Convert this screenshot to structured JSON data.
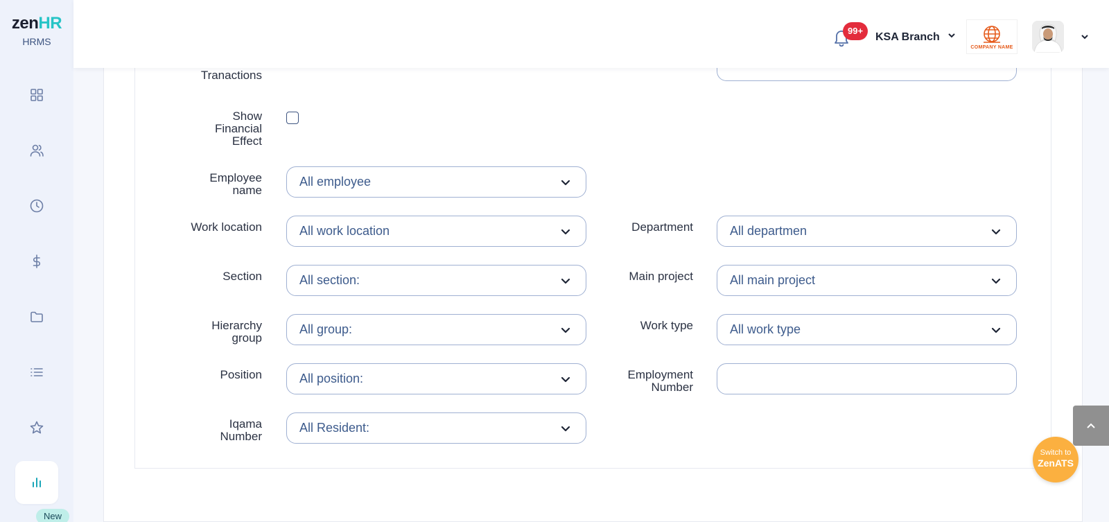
{
  "brand": {
    "logo_part1": "zen",
    "logo_part2": "HR",
    "subtitle": "HRMS",
    "accent": "#26c4c6"
  },
  "sidebar": {
    "items": [
      {
        "icon": "grid-icon"
      },
      {
        "icon": "users-icon"
      },
      {
        "icon": "clock-icon"
      },
      {
        "icon": "dollar-icon"
      },
      {
        "icon": "folder-icon"
      },
      {
        "icon": "list-icon"
      },
      {
        "icon": "star-icon"
      },
      {
        "icon": "bar-chart-icon",
        "active": true
      }
    ],
    "new_badge": "New"
  },
  "header": {
    "notifications": "99+",
    "branch": "KSA Branch",
    "company_name": "COMPANY NAME"
  },
  "form": {
    "partial_top_left_label": "Tranactions",
    "show_financial_effect": {
      "label_line1": "Show",
      "label_line2": "Financial",
      "label_line3": "Effect"
    },
    "employee_name": {
      "label_line1": "Employee",
      "label_line2": "name",
      "value": "All employee"
    },
    "work_location": {
      "label": "Work location",
      "value": "All work location"
    },
    "department": {
      "label": "Department",
      "value": "All departmen"
    },
    "section": {
      "label": "Section",
      "value": "All section:"
    },
    "main_project": {
      "label": "Main project",
      "value": "All main project"
    },
    "hierarchy_group": {
      "label_line1": "Hierarchy",
      "label_line2": "group",
      "value": "All group:"
    },
    "work_type": {
      "label": "Work type",
      "value": "All work type"
    },
    "position": {
      "label": "Position",
      "value": "All position:"
    },
    "employment_number": {
      "label_line1": "Employment",
      "label_line2": "Number",
      "value": ""
    },
    "iqama_number": {
      "label_line1": "Iqama",
      "label_line2": "Number",
      "value": "All Resident:"
    }
  },
  "floating": {
    "switch_line1": "Switch to",
    "switch_line2": "ZenATS"
  }
}
